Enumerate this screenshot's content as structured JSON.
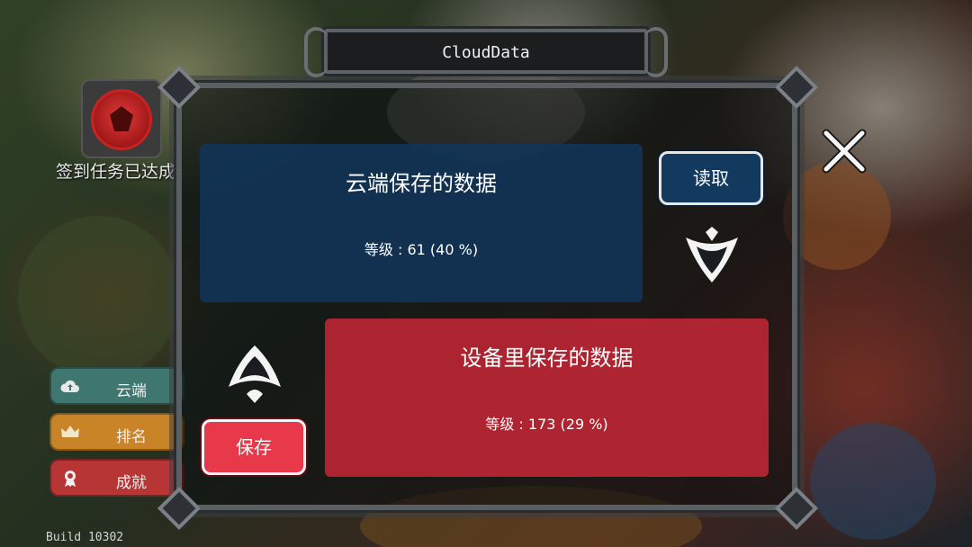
{
  "window": {
    "title": "CloudData"
  },
  "hud": {
    "checkin_label": "签到任务已达成",
    "side_buttons": [
      {
        "label": "云端",
        "icon": "cloud-upload-icon",
        "color": "#3f7670"
      },
      {
        "label": "排名",
        "icon": "crown-icon",
        "color": "#c98427"
      },
      {
        "label": "成就",
        "icon": "medal-icon",
        "color": "#b83535"
      }
    ],
    "build": "Build 10302"
  },
  "cloud": {
    "title": "云端保存的数据",
    "info": "等级 : 61 (40 %)",
    "load_button": "读取",
    "color": "#123458"
  },
  "device": {
    "title": "设备里保存的数据",
    "info": "等级 : 173 (29 %)",
    "save_button": "保存",
    "color": "#b92634"
  },
  "icons": {
    "close": "close-icon",
    "down_arrow": "download-arrow-icon",
    "up_arrow": "upload-arrow-icon"
  }
}
